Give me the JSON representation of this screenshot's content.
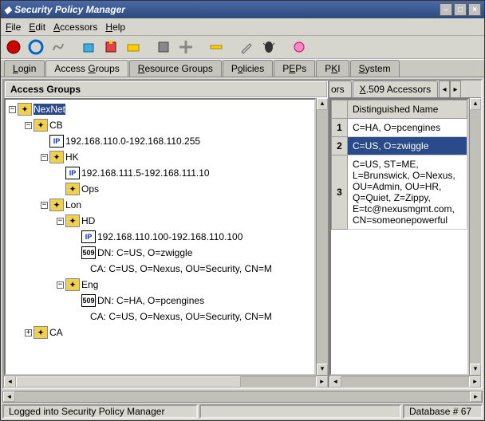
{
  "title": "Security Policy Manager",
  "menu": {
    "file": "File",
    "edit": "Edit",
    "accessors": "Accessors",
    "help": "Help"
  },
  "tabs": {
    "login": "Login",
    "access": "Access Groups",
    "resource": "Resource Groups",
    "policies": "Policies",
    "peps": "PEPs",
    "pki": "PKI",
    "system": "System"
  },
  "panel_header": "Access Groups",
  "tree": {
    "nexnet": "NexNet",
    "cb": "CB",
    "cb_ip": "192.168.110.0-192.168.110.255",
    "hk": "HK",
    "hk_ip": "192.168.111.5-192.168.111.10",
    "ops": "Ops",
    "lon": "Lon",
    "hd": "HD",
    "hd_ip": "192.168.110.100-192.168.110.100",
    "hd_dn": "DN: C=US, O=zwiggle",
    "hd_ca": "CA: C=US, O=Nexus, OU=Security, CN=M",
    "eng": "Eng",
    "eng_dn": "DN: C=HA, O=pcengines",
    "eng_ca": "CA: C=US, O=Nexus, OU=Security, CN=M",
    "ca": "CA"
  },
  "right_tabs": {
    "partial": "ors",
    "x509": "X.509 Accessors"
  },
  "table_header": "Distinguished Name",
  "rows": [
    {
      "n": "1",
      "dn": "C=HA, O=pcengines"
    },
    {
      "n": "2",
      "dn": "C=US, O=zwiggle"
    },
    {
      "n": "3",
      "dn": "C=US, ST=ME, L=Brunswick, O=Nexus, OU=Admin, OU=HR, Q=Quiet, Z=Zippy, E=tc@nexusmgmt.com, CN=someonepowerful"
    }
  ],
  "status": {
    "left": "Logged into Security Policy Manager",
    "right": "Database # 67"
  },
  "icons": {
    "ip": "IP",
    "x509": "509"
  }
}
